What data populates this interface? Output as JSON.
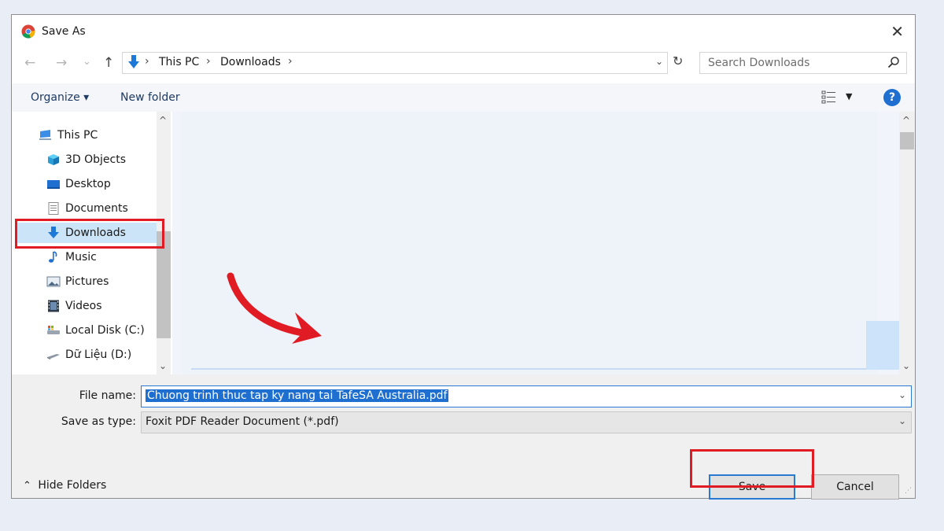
{
  "window": {
    "title": "Save As",
    "close_label": "✕"
  },
  "nav": {
    "back": "←",
    "forward": "→",
    "recent": "⌄",
    "up": "↑"
  },
  "address": {
    "crumbs": [
      "This PC",
      "Downloads"
    ],
    "separator": "›"
  },
  "search": {
    "placeholder": "Search Downloads"
  },
  "toolbar": {
    "organize": "Organize ▾",
    "new_folder": "New folder",
    "help": "?"
  },
  "sidebar": {
    "items": [
      {
        "label": "This PC",
        "icon": "computer-icon"
      },
      {
        "label": "3D Objects",
        "icon": "cube-icon"
      },
      {
        "label": "Desktop",
        "icon": "desktop-icon"
      },
      {
        "label": "Documents",
        "icon": "documents-icon"
      },
      {
        "label": "Downloads",
        "icon": "download-icon",
        "selected": true
      },
      {
        "label": "Music",
        "icon": "music-icon"
      },
      {
        "label": "Pictures",
        "icon": "pictures-icon"
      },
      {
        "label": "Videos",
        "icon": "videos-icon"
      },
      {
        "label": "Local Disk (C:)",
        "icon": "drive-icon"
      },
      {
        "label": "Dữ Liệu (D:)",
        "icon": "drive-icon"
      }
    ]
  },
  "form": {
    "filename_label": "File name:",
    "filename_value": "Chuong trinh thuc tap ky nang tai TafeSA Australia.pdf",
    "type_label": "Save as type:",
    "type_value": "Foxit PDF Reader Document (*.pdf)"
  },
  "footer": {
    "hide_folders": "Hide Folders",
    "save": "Save",
    "cancel": "Cancel"
  },
  "colors": {
    "accent": "#1e6fd0",
    "highlight": "#e01b24",
    "selection": "#cce4f7"
  }
}
